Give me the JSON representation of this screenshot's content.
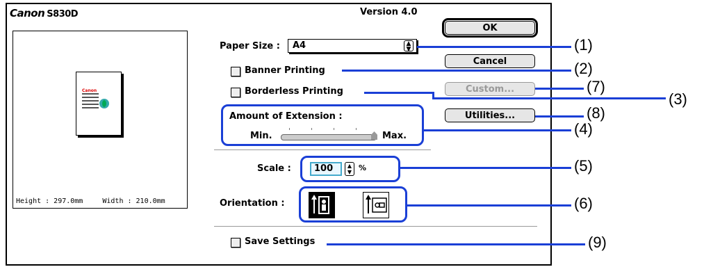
{
  "header": {
    "brand": "Canon",
    "model": "S830D",
    "version": "Version 4.0"
  },
  "preview": {
    "page_text": "Canon",
    "height": "Height : 297.0mm",
    "width": "Width : 210.0mm"
  },
  "form": {
    "paper_size_label": "Paper Size :",
    "paper_size_value": "A4",
    "banner_label": "Banner Printing",
    "borderless_label": "Borderless Printing",
    "extension_label": "Amount of Extension :",
    "extension_min": "Min.",
    "extension_max": "Max.",
    "extension_value_fraction": 1.0,
    "scale_label": "Scale :",
    "scale_value": "100",
    "scale_unit": "%",
    "orientation_label": "Orientation :",
    "save_label": "Save Settings"
  },
  "buttons": {
    "ok": "OK",
    "cancel": "Cancel",
    "custom": "Custom...",
    "utilities": "Utilities..."
  },
  "callouts": [
    "(1)",
    "(2)",
    "(3)",
    "(4)",
    "(5)",
    "(6)",
    "(7)",
    "(8)",
    "(9)"
  ],
  "colors": {
    "callout": "#1a3fd6",
    "scale_field": "#e9f7ff"
  },
  "icons": [
    "up-down-arrows-icon",
    "portrait-orientation-icon",
    "landscape-orientation-icon",
    "leaf-icon"
  ]
}
